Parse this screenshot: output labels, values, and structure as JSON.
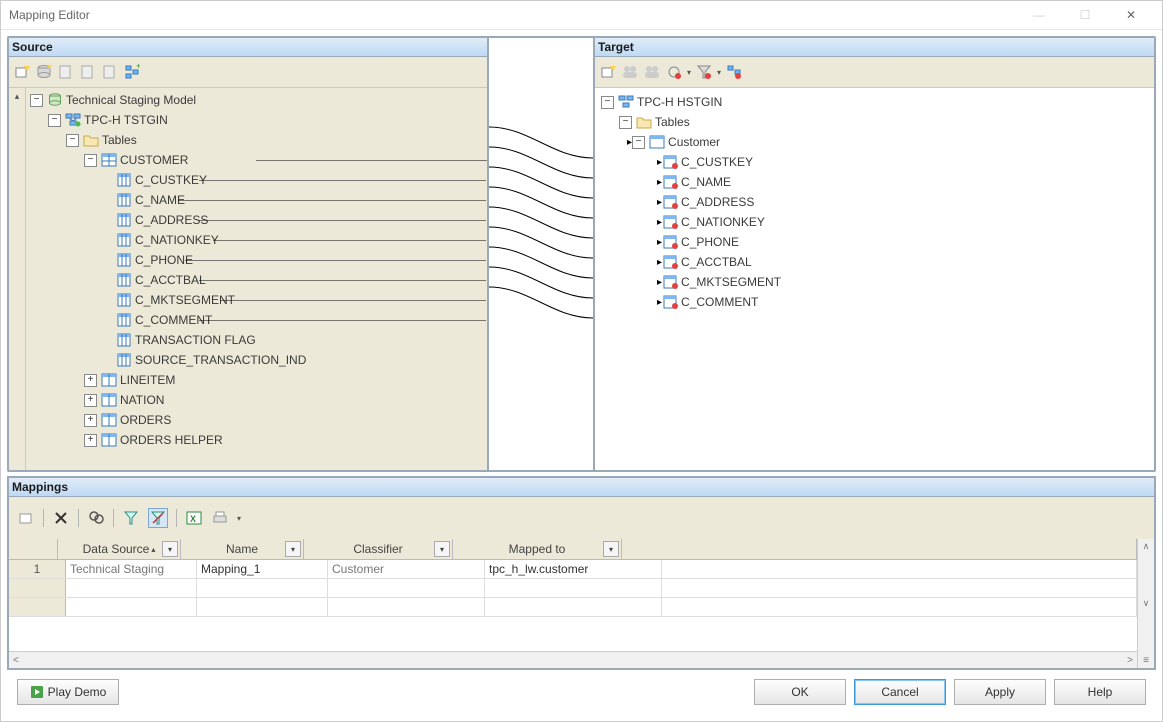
{
  "window": {
    "title": "Mapping Editor"
  },
  "panels": {
    "source_title": "Source",
    "target_title": "Target",
    "mappings_title": "Mappings"
  },
  "source_tree": {
    "root": "Technical Staging Model",
    "db": "TPC-H TSTGIN",
    "tables_label": "Tables",
    "customer_table": "CUSTOMER",
    "customer_cols": [
      "C_CUSTKEY",
      "C_NAME",
      "C_ADDRESS",
      "C_NATIONKEY",
      "C_PHONE",
      "C_ACCTBAL",
      "C_MKTSEGMENT",
      "C_COMMENT",
      "TRANSACTION FLAG",
      "SOURCE_TRANSACTION_IND"
    ],
    "other_tables": [
      "LINEITEM",
      "NATION",
      "ORDERS",
      "ORDERS HELPER"
    ]
  },
  "target_tree": {
    "db": "TPC-H HSTGIN",
    "tables_label": "Tables",
    "customer_table": "Customer",
    "customer_cols": [
      "C_CUSTKEY",
      "C_NAME",
      "C_ADDRESS",
      "C_NATIONKEY",
      "C_PHONE",
      "C_ACCTBAL",
      "C_MKTSEGMENT",
      "C_COMMENT"
    ]
  },
  "grid": {
    "headers": {
      "data_source": "Data Source",
      "name": "Name",
      "classifier": "Classifier",
      "mapped_to": "Mapped to"
    },
    "row": {
      "num": "1",
      "data_source": "Technical Staging",
      "name": "Mapping_1",
      "classifier": "Customer",
      "mapped_to": "tpc_h_lw.customer"
    }
  },
  "buttons": {
    "play_demo": "Play Demo",
    "ok": "OK",
    "cancel": "Cancel",
    "apply": "Apply",
    "help": "Help"
  }
}
